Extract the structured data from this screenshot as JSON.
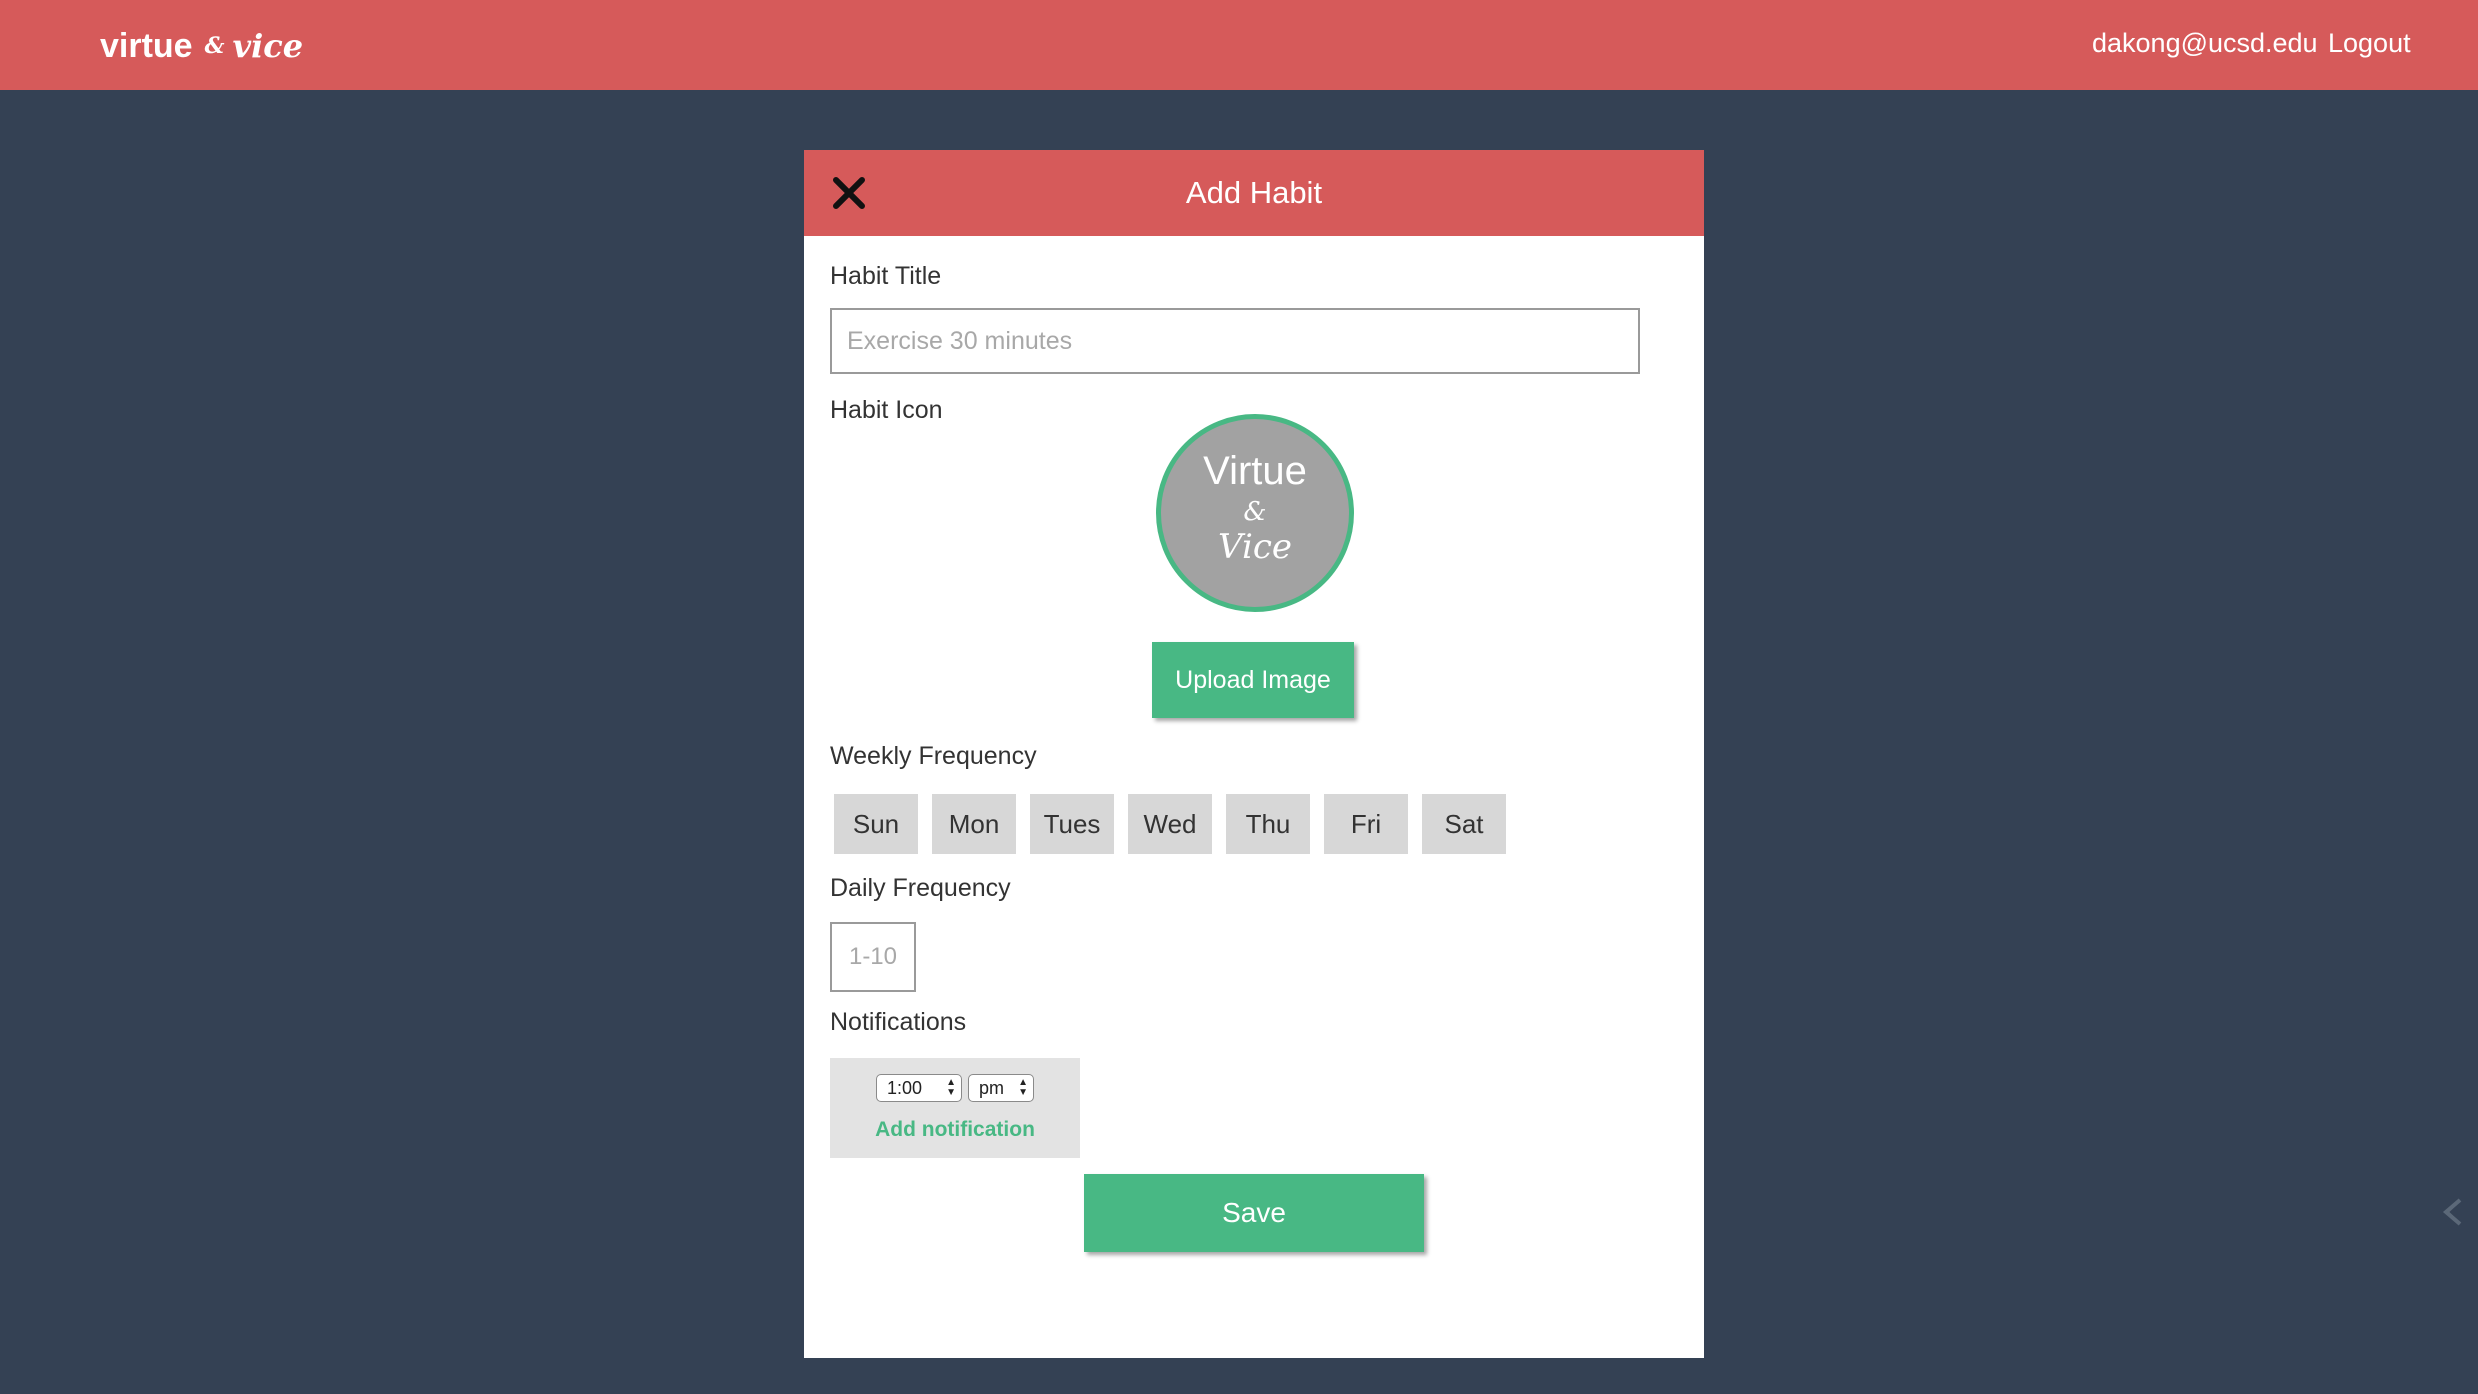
{
  "navbar": {
    "brand_virtue": "virtue",
    "brand_amp": "&",
    "brand_vice": "vice",
    "email": "dakong@ucsd.edu",
    "logout_label": "Logout"
  },
  "modal": {
    "title": "Add Habit",
    "habit_title_label": "Habit Title",
    "habit_title_placeholder": "Exercise 30 minutes",
    "habit_icon_label": "Habit Icon",
    "icon_text": {
      "virtue": "Virtue",
      "amp": "&",
      "vice": "Vice"
    },
    "upload_label": "Upload Image",
    "weekly_label": "Weekly Frequency",
    "days": [
      "Sun",
      "Mon",
      "Tues",
      "Wed",
      "Thu",
      "Fri",
      "Sat"
    ],
    "daily_label": "Daily Frequency",
    "daily_placeholder": "1-10",
    "notifications_label": "Notifications",
    "notification_time": "1:00",
    "notification_ampm": "pm",
    "add_notification_label": "Add notification",
    "save_label": "Save"
  },
  "colors": {
    "accent_red": "#d65a5a",
    "accent_green": "#48b884",
    "background": "#344154",
    "day_button": "#d7d7d7"
  }
}
